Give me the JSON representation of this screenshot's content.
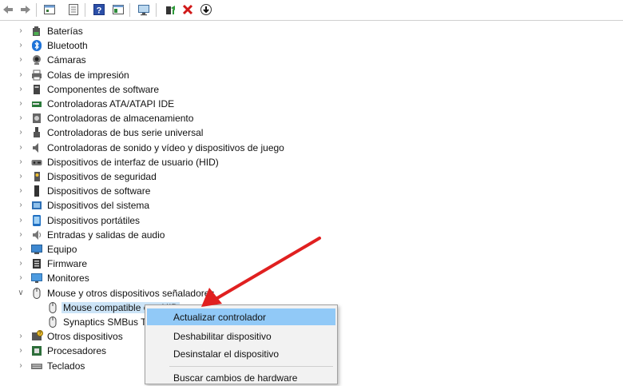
{
  "toolbar": {
    "icons": [
      "back-icon",
      "forward-icon",
      "properties-icon",
      "scan-icon",
      "help-icon",
      "view-icon",
      "monitor-icon",
      "update-driver-icon",
      "uninstall-icon",
      "download-icon"
    ]
  },
  "tree": {
    "items": [
      {
        "label": "Baterías",
        "icon": "battery-icon"
      },
      {
        "label": "Bluetooth",
        "icon": "bluetooth-icon"
      },
      {
        "label": "Cámaras",
        "icon": "camera-icon"
      },
      {
        "label": "Colas de impresión",
        "icon": "printer-icon"
      },
      {
        "label": "Componentes de software",
        "icon": "software-component-icon"
      },
      {
        "label": "Controladoras ATA/ATAPI IDE",
        "icon": "ide-controller-icon"
      },
      {
        "label": "Controladoras de almacenamiento",
        "icon": "storage-controller-icon"
      },
      {
        "label": "Controladoras de bus serie universal",
        "icon": "usb-icon"
      },
      {
        "label": "Controladoras de sonido y vídeo y dispositivos de juego",
        "icon": "sound-icon"
      },
      {
        "label": "Dispositivos de interfaz de usuario (HID)",
        "icon": "hid-icon"
      },
      {
        "label": "Dispositivos de seguridad",
        "icon": "security-icon"
      },
      {
        "label": "Dispositivos de software",
        "icon": "software-device-icon"
      },
      {
        "label": "Dispositivos del sistema",
        "icon": "system-device-icon"
      },
      {
        "label": "Dispositivos portátiles",
        "icon": "portable-device-icon"
      },
      {
        "label": "Entradas y salidas de audio",
        "icon": "audio-icon"
      },
      {
        "label": "Equipo",
        "icon": "computer-icon"
      },
      {
        "label": "Firmware",
        "icon": "firmware-icon"
      },
      {
        "label": "Monitores",
        "icon": "monitor-icon"
      },
      {
        "label": "Mouse y otros dispositivos señaladores",
        "icon": "mouse-icon"
      }
    ],
    "mouse_children": [
      {
        "label": "Mouse compatible con HID",
        "icon": "mouse-icon"
      },
      {
        "label": "Synaptics SMBus TouchPad",
        "icon": "mouse-icon"
      }
    ],
    "after": [
      {
        "label": "Otros dispositivos",
        "icon": "unknown-device-icon"
      },
      {
        "label": "Procesadores",
        "icon": "processor-icon"
      },
      {
        "label": "Teclados",
        "icon": "keyboard-icon"
      }
    ]
  },
  "context_menu": {
    "items": [
      "Actualizar controlador",
      "Deshabilitar dispositivo",
      "Desinstalar el dispositivo",
      "Buscar cambios de hardware"
    ]
  },
  "colors": {
    "highlight": "#91c9f7",
    "arrow": "#e02020",
    "selected": "#cce4f7"
  }
}
